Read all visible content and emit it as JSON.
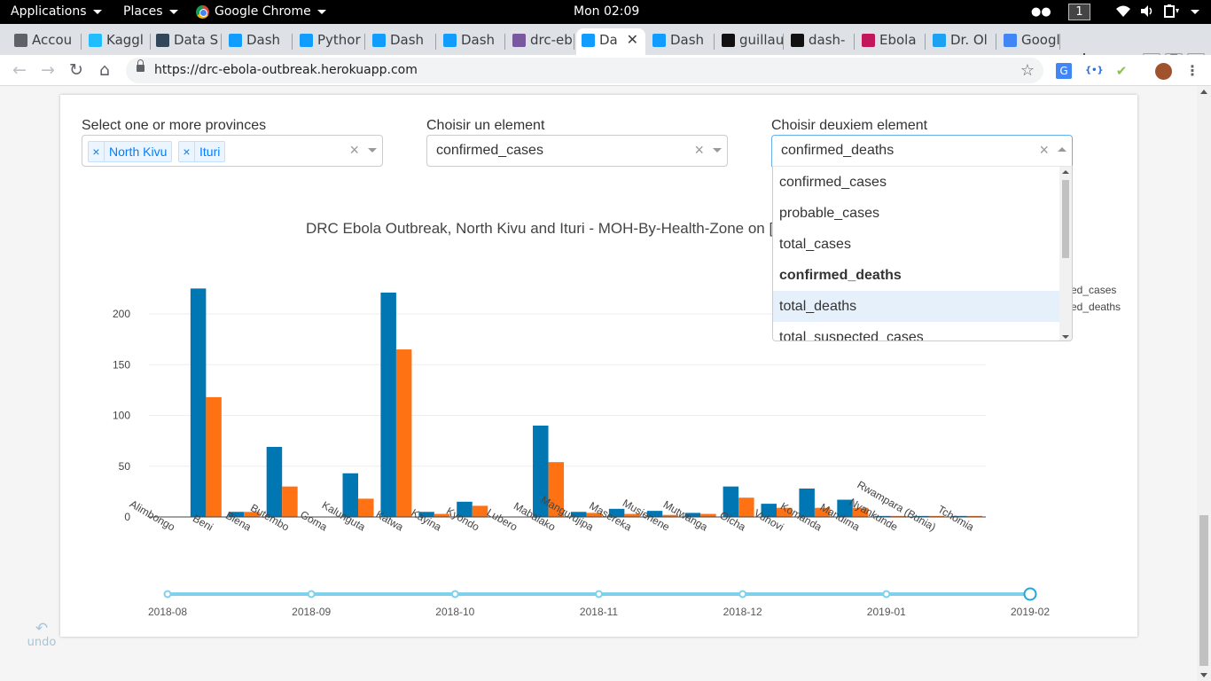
{
  "os": {
    "applications": "Applications",
    "places": "Places",
    "active_app": "Google Chrome",
    "clock": "Mon 02:09",
    "workspace": "1"
  },
  "tabs": [
    {
      "label": "Accou",
      "icon": "brain-icon",
      "color": "#5f6368"
    },
    {
      "label": "Kaggl",
      "icon": "kaggle-icon",
      "color": "#20beff"
    },
    {
      "label": "Data S",
      "icon": "datacamp-icon",
      "color": "#33475b"
    },
    {
      "label": "Dash",
      "icon": "dash-icon",
      "color": "#119dff"
    },
    {
      "label": "Pythor",
      "icon": "plotly-bar-icon",
      "color": "#119dff"
    },
    {
      "label": "Dash",
      "icon": "dash-icon",
      "color": "#119dff"
    },
    {
      "label": "Dash",
      "icon": "dash-icon",
      "color": "#119dff"
    },
    {
      "label": "drc-eb",
      "icon": "heroku-icon",
      "color": "#79589f"
    },
    {
      "label": "Da",
      "icon": "dash-icon",
      "color": "#119dff",
      "active": true
    },
    {
      "label": "Dash",
      "icon": "dash-icon",
      "color": "#119dff"
    },
    {
      "label": "guillau",
      "icon": "github-icon",
      "color": "#111111"
    },
    {
      "label": "dash-",
      "icon": "github-icon",
      "color": "#111111"
    },
    {
      "label": "Ebola",
      "icon": "network-icon",
      "color": "#c2185b"
    },
    {
      "label": "Dr. Ol",
      "icon": "twitter-icon",
      "color": "#1da1f2"
    },
    {
      "label": "Googl",
      "icon": "google-translate-icon",
      "color": "#4285f4"
    }
  ],
  "address": {
    "url": "https://drc-ebola-outbreak.herokuapp.com"
  },
  "controls": {
    "provinces_label": "Select one or more provinces",
    "provinces_selected": [
      "North Kivu",
      "Ituri"
    ],
    "element1_label": "Choisir un element",
    "element1_value": "confirmed_cases",
    "element2_label": "Choisir deuxiem element",
    "element2_value": "confirmed_deaths",
    "dropdown_options": [
      "confirmed_cases",
      "probable_cases",
      "total_cases",
      "confirmed_deaths",
      "total_deaths",
      "total_suspected_cases"
    ],
    "dropdown_selected_index": 3,
    "dropdown_hover_index": 4
  },
  "undo_label": "undo",
  "chart_data": {
    "type": "bar",
    "title": "DRC Ebola Outbreak, North Kivu and Ituri - MOH-By-Health-Zone on [",
    "categories": [
      "Alimbongo",
      "Beni",
      "Biena",
      "Butembo",
      "Goma",
      "Kalunguta",
      "Katwa",
      "Kayina",
      "Kyondo",
      "Lubero",
      "Mabalako",
      "Mangurujipa",
      "Masereka",
      "Musienene",
      "Mutwanga",
      "Oicha",
      "Vuhovi",
      "Komanda",
      "Mandima",
      "Nyankunde",
      "Rwampara (Bunia)",
      "Tchomia"
    ],
    "series": [
      {
        "name": "ed_cases",
        "color": "#0076b3",
        "values": [
          0,
          225,
          5,
          69,
          0,
          43,
          221,
          5,
          15,
          0,
          90,
          5,
          8,
          6,
          4,
          30,
          13,
          28,
          17,
          1,
          1,
          1
        ]
      },
      {
        "name": "ed_deaths",
        "color": "#ff7214",
        "values": [
          0,
          118,
          5,
          30,
          0,
          18,
          165,
          3,
          11,
          0,
          54,
          4,
          3,
          2,
          3,
          19,
          9,
          9,
          9,
          1,
          1,
          1
        ]
      }
    ],
    "ylim": [
      0,
      235
    ],
    "yticks": [
      0,
      50,
      100,
      150,
      200
    ],
    "grid": true,
    "legend": "top-right"
  },
  "slider": {
    "marks": [
      "2018-08",
      "2018-09",
      "2018-10",
      "2018-11",
      "2018-12",
      "2019-01",
      "2019-02"
    ],
    "selected_index": 6,
    "color": "#7fd0ec",
    "handle_color": "#1fa8d8"
  }
}
